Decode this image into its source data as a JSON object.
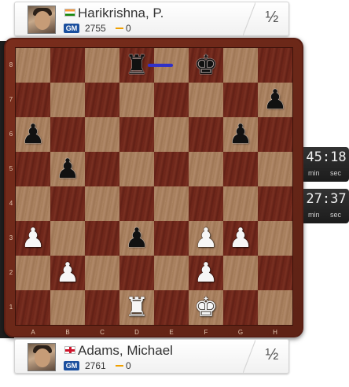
{
  "top_player": {
    "name": "Harikrishna, P.",
    "title": "GM",
    "rating": "2755",
    "points": "0",
    "score": "½",
    "flag": "india-flag"
  },
  "bottom_player": {
    "name": "Adams, Michael",
    "title": "GM",
    "rating": "2761",
    "points": "0",
    "score": "½",
    "flag": "england-flag"
  },
  "clocks": {
    "top": {
      "value": "45:18",
      "min_label": "min",
      "sec_label": "sec"
    },
    "bottom": {
      "value": "27:37",
      "min_label": "min",
      "sec_label": "sec"
    }
  },
  "board": {
    "ranks": [
      "8",
      "7",
      "6",
      "5",
      "4",
      "3",
      "2",
      "1"
    ],
    "files": [
      "A",
      "B",
      "C",
      "D",
      "E",
      "F",
      "G",
      "H"
    ],
    "colors": {
      "light": "#a7805e",
      "dark": "#6e271b",
      "frame": "#5a1e13",
      "move_arrow": "#2f31c9"
    },
    "last_move": {
      "from": "e8",
      "to": "d8"
    },
    "pieces": [
      {
        "square": "d8",
        "piece": "rook",
        "color": "black",
        "glyph": "♜"
      },
      {
        "square": "f8",
        "piece": "king",
        "color": "black",
        "glyph": "♚"
      },
      {
        "square": "h7",
        "piece": "pawn",
        "color": "black",
        "glyph": "♟"
      },
      {
        "square": "a6",
        "piece": "pawn",
        "color": "black",
        "glyph": "♟"
      },
      {
        "square": "g6",
        "piece": "pawn",
        "color": "black",
        "glyph": "♟"
      },
      {
        "square": "b5",
        "piece": "pawn",
        "color": "black",
        "glyph": "♟"
      },
      {
        "square": "d3",
        "piece": "pawn",
        "color": "black",
        "glyph": "♟"
      },
      {
        "square": "a3",
        "piece": "pawn",
        "color": "white",
        "glyph": "♟"
      },
      {
        "square": "f3",
        "piece": "pawn",
        "color": "white",
        "glyph": "♟"
      },
      {
        "square": "g3",
        "piece": "pawn",
        "color": "white",
        "glyph": "♟"
      },
      {
        "square": "b2",
        "piece": "pawn",
        "color": "white",
        "glyph": "♟"
      },
      {
        "square": "f2",
        "piece": "pawn",
        "color": "white",
        "glyph": "♟"
      },
      {
        "square": "d1",
        "piece": "rook",
        "color": "white",
        "glyph": "♜"
      },
      {
        "square": "f1",
        "piece": "king",
        "color": "white",
        "glyph": "♚"
      }
    ]
  }
}
